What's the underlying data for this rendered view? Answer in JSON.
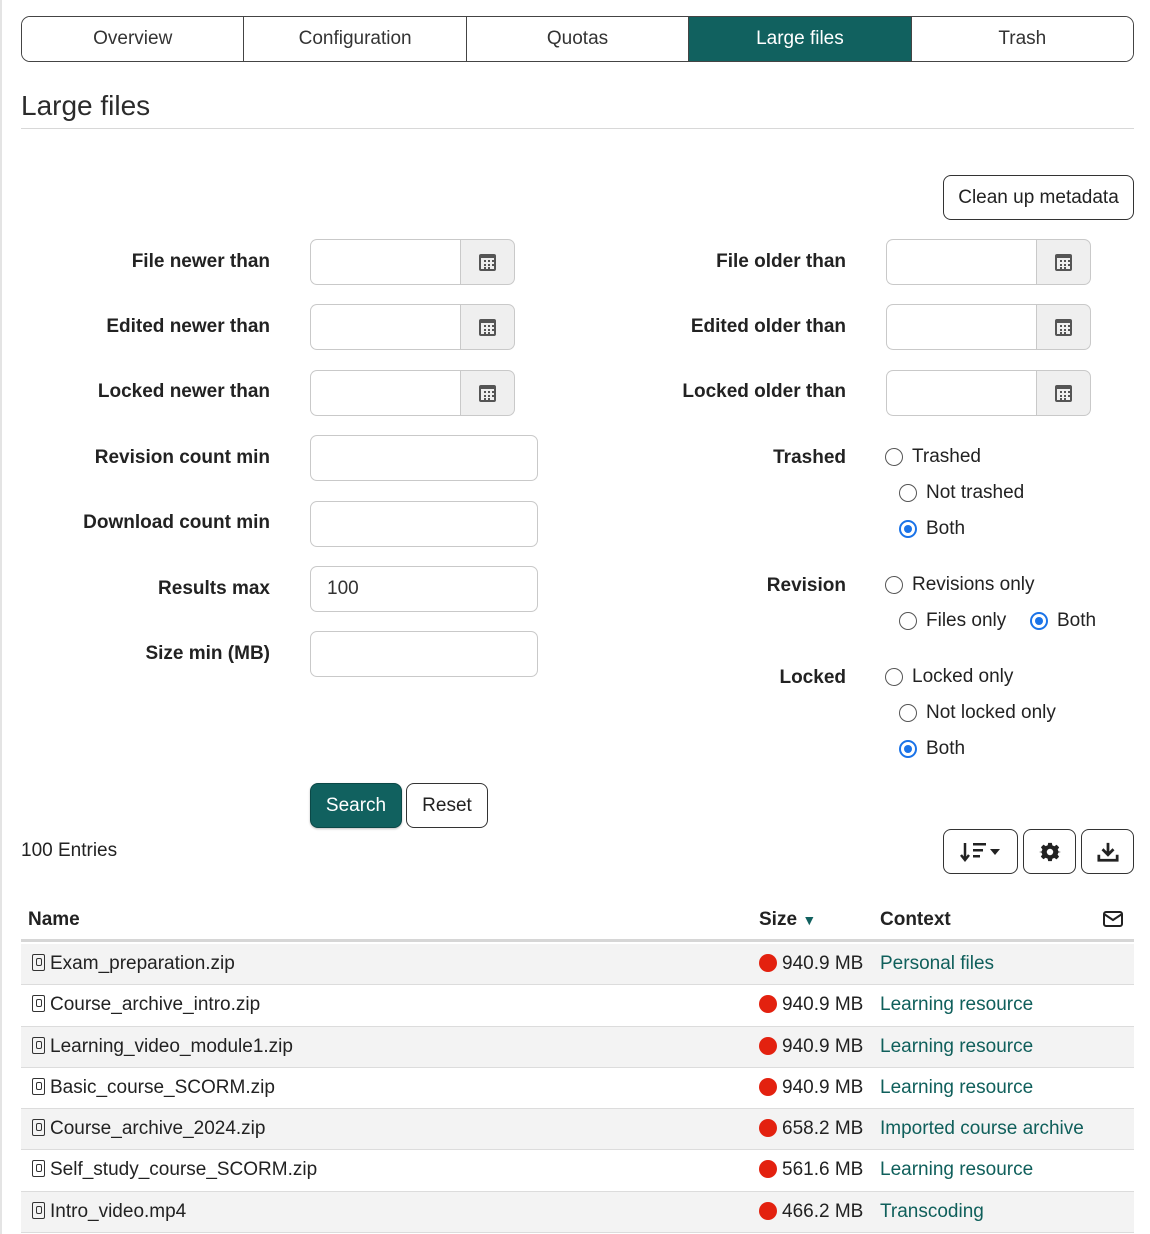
{
  "tabs": [
    "Overview",
    "Configuration",
    "Quotas",
    "Large files",
    "Trash"
  ],
  "active_tab": 3,
  "page_title": "Large files",
  "cleanup_button": "Clean up metadata",
  "left_fields": {
    "file_newer": "File newer than",
    "edited_newer": "Edited newer than",
    "locked_newer": "Locked newer than",
    "revision_min": "Revision count min",
    "download_min": "Download count min",
    "results_max": "Results max",
    "results_max_value": "100",
    "size_min": "Size min (MB)"
  },
  "right_fields": {
    "file_older": "File older than",
    "edited_older": "Edited older than",
    "locked_older": "Locked older than",
    "trashed_label": "Trashed",
    "trashed_opts": [
      "Trashed",
      "Not trashed",
      "Both"
    ],
    "revision_label": "Revision",
    "revision_opts": [
      "Revisions only",
      "Files only",
      "Both"
    ],
    "locked_label": "Locked",
    "locked_opts": [
      "Locked only",
      "Not locked only",
      "Both"
    ]
  },
  "search_button": "Search",
  "reset_button": "Reset",
  "entries": "100 Entries",
  "table": {
    "col_name": "Name",
    "col_size": "Size",
    "col_context": "Context",
    "rows": [
      {
        "name": "Exam_preparation.zip",
        "size": "940.9 MB",
        "context": "Personal files"
      },
      {
        "name": "Course_archive_intro.zip",
        "size": "940.9 MB",
        "context": "Learning resource"
      },
      {
        "name": "Learning_video_module1.zip",
        "size": "940.9 MB",
        "context": "Learning resource"
      },
      {
        "name": "Basic_course_SCORM.zip",
        "size": "940.9 MB",
        "context": "Learning resource"
      },
      {
        "name": "Course_archive_2024.zip",
        "size": "658.2 MB",
        "context": "Imported course archive"
      },
      {
        "name": "Self_study_course_SCORM.zip",
        "size": "561.6 MB",
        "context": "Learning resource"
      },
      {
        "name": "Intro_video.mp4",
        "size": "466.2 MB",
        "context": "Transcoding"
      }
    ]
  },
  "colors": {
    "accent": "#11615f",
    "radio": "#1a73e8",
    "status_red": "#e3210f"
  }
}
